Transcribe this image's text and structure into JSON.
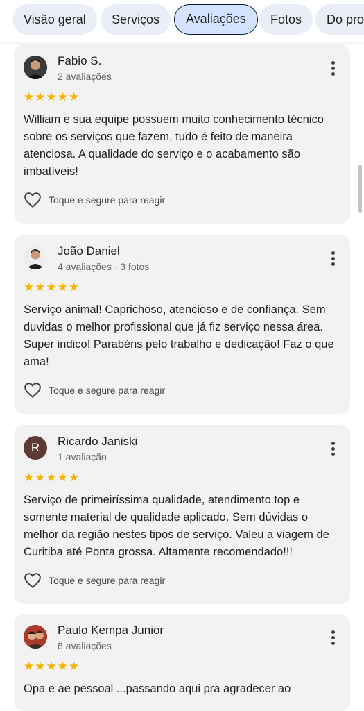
{
  "tabs": [
    {
      "label": "Visão geral"
    },
    {
      "label": "Serviços"
    },
    {
      "label": "Avaliações"
    },
    {
      "label": "Fotos"
    },
    {
      "label": "Do prop"
    }
  ],
  "reviews": [
    {
      "name": "Fabio S.",
      "meta": "2 avaliações",
      "stars": "★★★★★",
      "rating": 5,
      "text": "William e sua equipe possuem muito conhecimento técnico sobre os serviços que fazem, tudo é feito de maneira atenciosa. A qualidade do serviço e o acabamento são imbatíveis!",
      "react_label": "Toque e segure para reagir"
    },
    {
      "name": "João Daniel",
      "meta": "4 avaliações · 3 fotos",
      "stars": "★★★★★",
      "rating": 5,
      "text": "Serviço animal! Caprichoso, atencioso e de confiança. Sem duvidas o melhor profissional que já fiz serviço nessa área. Super indico! Parabéns pelo trabalho e dedicação! Faz o que ama!",
      "react_label": "Toque e segure para reagir"
    },
    {
      "name": "Ricardo Janiski",
      "meta": "1 avaliação",
      "avatar_letter": "R",
      "stars": "★★★★★",
      "rating": 5,
      "text": "Serviço de primeiríssima qualidade, atendimento top e somente material de qualidade aplicado. Sem dúvidas o melhor da região nestes tipos de serviço. Valeu a viagem de Curitiba até Ponta grossa. Altamente recomendado!!!",
      "react_label": "Toque e segure para reagir"
    },
    {
      "name": "Paulo Kempa Junior",
      "meta": "8 avaliações",
      "stars": "★★★★★",
      "rating": 5,
      "text": "Opa e ae pessoal ...passando aqui pra agradecer ao"
    }
  ],
  "colors": {
    "star": "#f6b300",
    "active_tab_bg": "#d3e3fd",
    "card_bg": "#f2f2f2",
    "avatar_r_bg": "#5d3a33"
  }
}
